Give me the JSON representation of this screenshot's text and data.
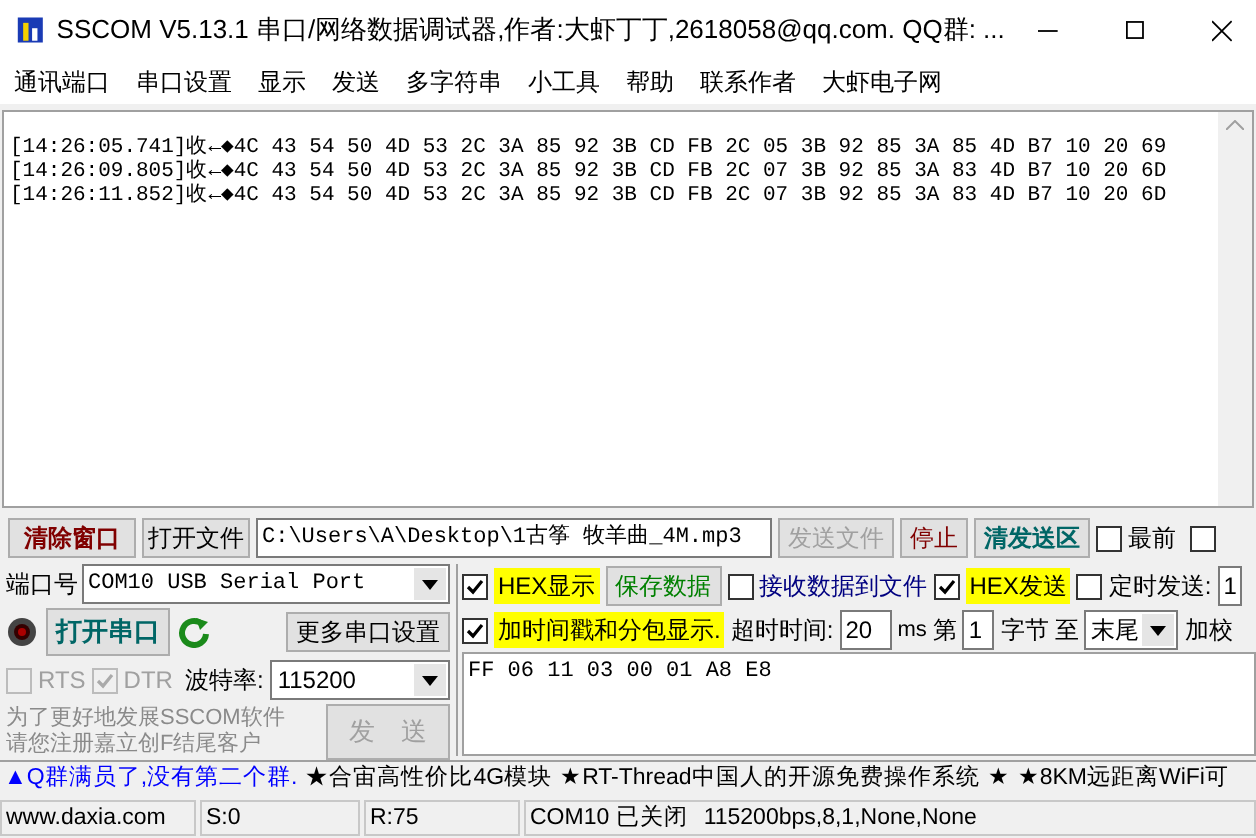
{
  "window": {
    "title": "SSCOM V5.13.1 串口/网络数据调试器,作者:大虾丁丁,2618058@qq.com. QQ群: ..."
  },
  "menu": [
    "通讯端口",
    "串口设置",
    "显示",
    "发送",
    "多字符串",
    "小工具",
    "帮助",
    "联系作者",
    "大虾电子网"
  ],
  "receive": {
    "lines": [
      {
        "time": "[14:26:05.741]收←◆",
        "data": "4C 43 54 50 4D 53 2C 3A 85 92 3B CD FB 2C 05 3B 92 85 3A 85 4D B7 10 20 69"
      },
      {
        "time": "[14:26:09.805]收←◆",
        "data": "4C 43 54 50 4D 53 2C 3A 85 92 3B CD FB 2C 07 3B 92 85 3A 83 4D B7 10 20 6D"
      },
      {
        "time": "[14:26:11.852]收←◆",
        "data": "4C 43 54 50 4D 53 2C 3A 85 92 3B CD FB 2C 07 3B 92 85 3A 83 4D B7 10 20 6D"
      }
    ]
  },
  "file_row": {
    "clear_button": "清除窗口",
    "open_file_button": "打开文件",
    "file_path": "C:\\Users\\A\\Desktop\\1古筝 牧羊曲_4M.mp3",
    "send_file_button": {
      "label": "发送文件",
      "disabled": true
    },
    "stop_button": "停止",
    "clear_send_button": "清发送区",
    "topmost": {
      "label": "最前",
      "checked": false
    },
    "checkbox_6": {
      "checked": false
    }
  },
  "port": {
    "label": "端口号",
    "value": "COM10 USB Serial Port",
    "open_button": "打开串口",
    "more_settings_button": "更多串口设置",
    "rts": {
      "label": "RTS",
      "checked": false,
      "disabled": true
    },
    "dtr": {
      "label": "DTR",
      "checked": true,
      "disabled": true
    },
    "baud_label": "波特率:",
    "baud": "115200"
  },
  "promo": [
    "为了更好地发展SSCOM软件",
    "请您注册嘉立创F结尾客户"
  ],
  "send_button": {
    "label": "发　送",
    "disabled": true
  },
  "options": {
    "hex_display": {
      "label": "HEX显示",
      "checked": true
    },
    "save_data_button": "保存数据",
    "receive_to_file": {
      "label": "接收数据到文件",
      "checked": false
    },
    "hex_send": {
      "label": "HEX发送",
      "checked": true
    },
    "timed_send": {
      "label": "定时发送:",
      "checked": false
    },
    "timed_value": "1",
    "timestamp": {
      "label": "加时间戳和分包显示.",
      "checked": true
    },
    "timeout_label": "超时时间:",
    "timeout": "20",
    "ms": "ms",
    "byte_from_label": "第",
    "byte_from": "1",
    "byte_label": "字节",
    "to_label": "至",
    "to_value": "末尾",
    "checksum_label": "加校"
  },
  "send_text": "FF 06 11 03 00 01 A8 E8",
  "ticker": [
    {
      "text": "▲Q群满员了,没有第二个群.",
      "color": "#0000ff"
    },
    {
      "text": "★合宙高性价比4G模块",
      "color": "#000000"
    },
    {
      "text": "★RT-Thread中国人的开源免费操作系统",
      "color": "#000000"
    },
    {
      "text": "★",
      "color": "#000000"
    },
    {
      "text": "★8KM远距离WiFi可",
      "color": "#000000"
    }
  ],
  "status": {
    "site": "www.daxia.com",
    "sent": "S:0",
    "received": "R:75",
    "port_state": "COM10 已关闭",
    "params": "115200bps,8,1,None,None"
  }
}
